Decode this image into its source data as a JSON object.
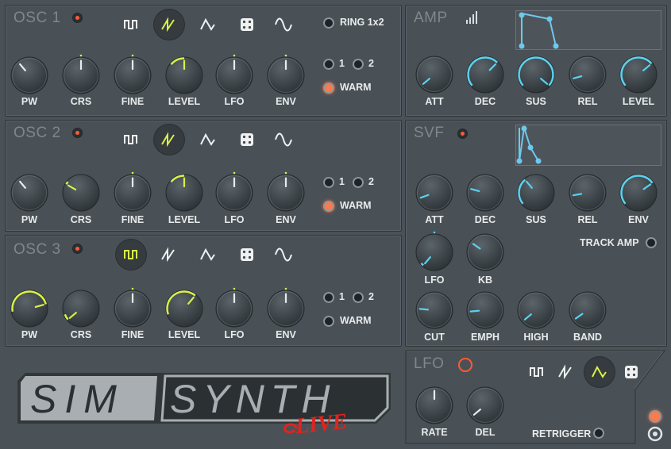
{
  "colors": {
    "accent_yellow": "#d8f04a",
    "accent_cyan": "#5ad2f0",
    "led": "#ff5a32",
    "panel": "#4a5156"
  },
  "osc1": {
    "title": "OSC 1",
    "ring_label": "RING 1x2",
    "radio1": "1",
    "radio2": "2",
    "warm_label": "WARM",
    "knobs": [
      "PW",
      "CRS",
      "FINE",
      "LEVEL",
      "LFO",
      "ENV"
    ]
  },
  "osc2": {
    "title": "OSC 2",
    "radio1": "1",
    "radio2": "2",
    "warm_label": "WARM",
    "knobs": [
      "PW",
      "CRS",
      "FINE",
      "LEVEL",
      "LFO",
      "ENV"
    ]
  },
  "osc3": {
    "title": "OSC 3",
    "radio1": "1",
    "radio2": "2",
    "warm_label": "WARM",
    "knobs": [
      "PW",
      "CRS",
      "FINE",
      "LEVEL",
      "LFO",
      "ENV"
    ]
  },
  "amp": {
    "title": "AMP",
    "knobs": [
      "ATT",
      "DEC",
      "SUS",
      "REL",
      "LEVEL"
    ]
  },
  "svf": {
    "title": "SVF",
    "knobs_row1": [
      "ATT",
      "DEC",
      "SUS",
      "REL",
      "ENV"
    ],
    "track_amp_label": "TRACK AMP",
    "knobs_row2": [
      "LFO",
      "KB"
    ],
    "knobs_row3": [
      "CUT",
      "EMPH",
      "HIGH",
      "BAND"
    ]
  },
  "lfo": {
    "title": "LFO",
    "knobs": [
      "RATE",
      "DEL"
    ],
    "retrigger_label": "RETRIGGER"
  },
  "logo": {
    "sim": "SIM",
    "synth": "SYNTH",
    "live": "LIVE"
  },
  "icons": {
    "square": "square-wave-icon",
    "saw": "saw-wave-icon",
    "triangle": "triangle-wave-icon",
    "noise": "noise-dice-icon",
    "sine": "sine-wave-icon"
  }
}
